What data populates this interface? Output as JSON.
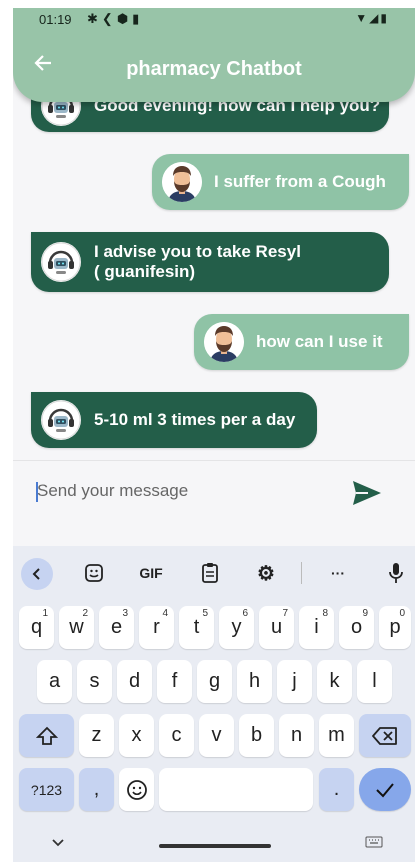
{
  "status_bar": {
    "time": "01:19"
  },
  "app_bar": {
    "title": "pharmacy Chatbot"
  },
  "messages": [
    {
      "sender": "bot",
      "text": "Good evening! how can I help you?"
    },
    {
      "sender": "user",
      "text": "I suffer from a Cough"
    },
    {
      "sender": "bot",
      "line1": "I advise you to take Resyl",
      "line2": "( guanifesin)"
    },
    {
      "sender": "user",
      "text": "how can I use it"
    },
    {
      "sender": "bot",
      "text": "5-10 ml 3 times per a day"
    }
  ],
  "composer": {
    "placeholder": "Send your message"
  },
  "keyboard": {
    "toolbar": {
      "gif_label": "GIF",
      "more_label": "···"
    },
    "row1": [
      {
        "k": "q",
        "n": "1"
      },
      {
        "k": "w",
        "n": "2"
      },
      {
        "k": "e",
        "n": "3"
      },
      {
        "k": "r",
        "n": "4"
      },
      {
        "k": "t",
        "n": "5"
      },
      {
        "k": "y",
        "n": "6"
      },
      {
        "k": "u",
        "n": "7"
      },
      {
        "k": "i",
        "n": "8"
      },
      {
        "k": "o",
        "n": "9"
      },
      {
        "k": "p",
        "n": "0"
      }
    ],
    "row2": [
      "a",
      "s",
      "d",
      "f",
      "g",
      "h",
      "j",
      "k",
      "l"
    ],
    "row3": [
      "z",
      "x",
      "c",
      "v",
      "b",
      "n",
      "m"
    ],
    "bottom": {
      "numbers_label": "?123",
      "comma": ",",
      "period": "."
    }
  }
}
